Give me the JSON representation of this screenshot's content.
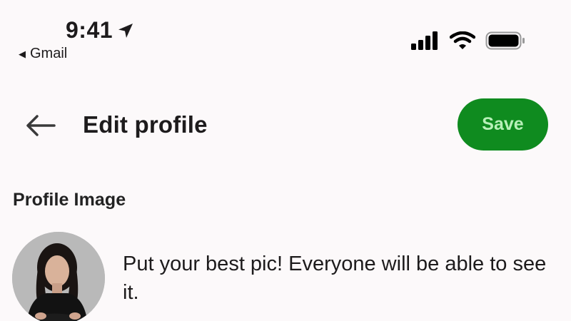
{
  "status_bar": {
    "time": "9:41",
    "back_app": "Gmail",
    "location_icon": "location-arrow-icon",
    "signal_icon": "cellular-signal-icon",
    "wifi_icon": "wifi-icon",
    "battery_icon": "battery-icon"
  },
  "header": {
    "back_icon": "back-arrow-icon",
    "title": "Edit profile",
    "save_label": "Save"
  },
  "profile": {
    "section_label": "Profile Image",
    "description": "Put your best pic! Everyone will be able to see it."
  },
  "colors": {
    "background": "#fcf9fa",
    "save_button": "#0f8b1f",
    "save_text": "#b8f0b8"
  }
}
